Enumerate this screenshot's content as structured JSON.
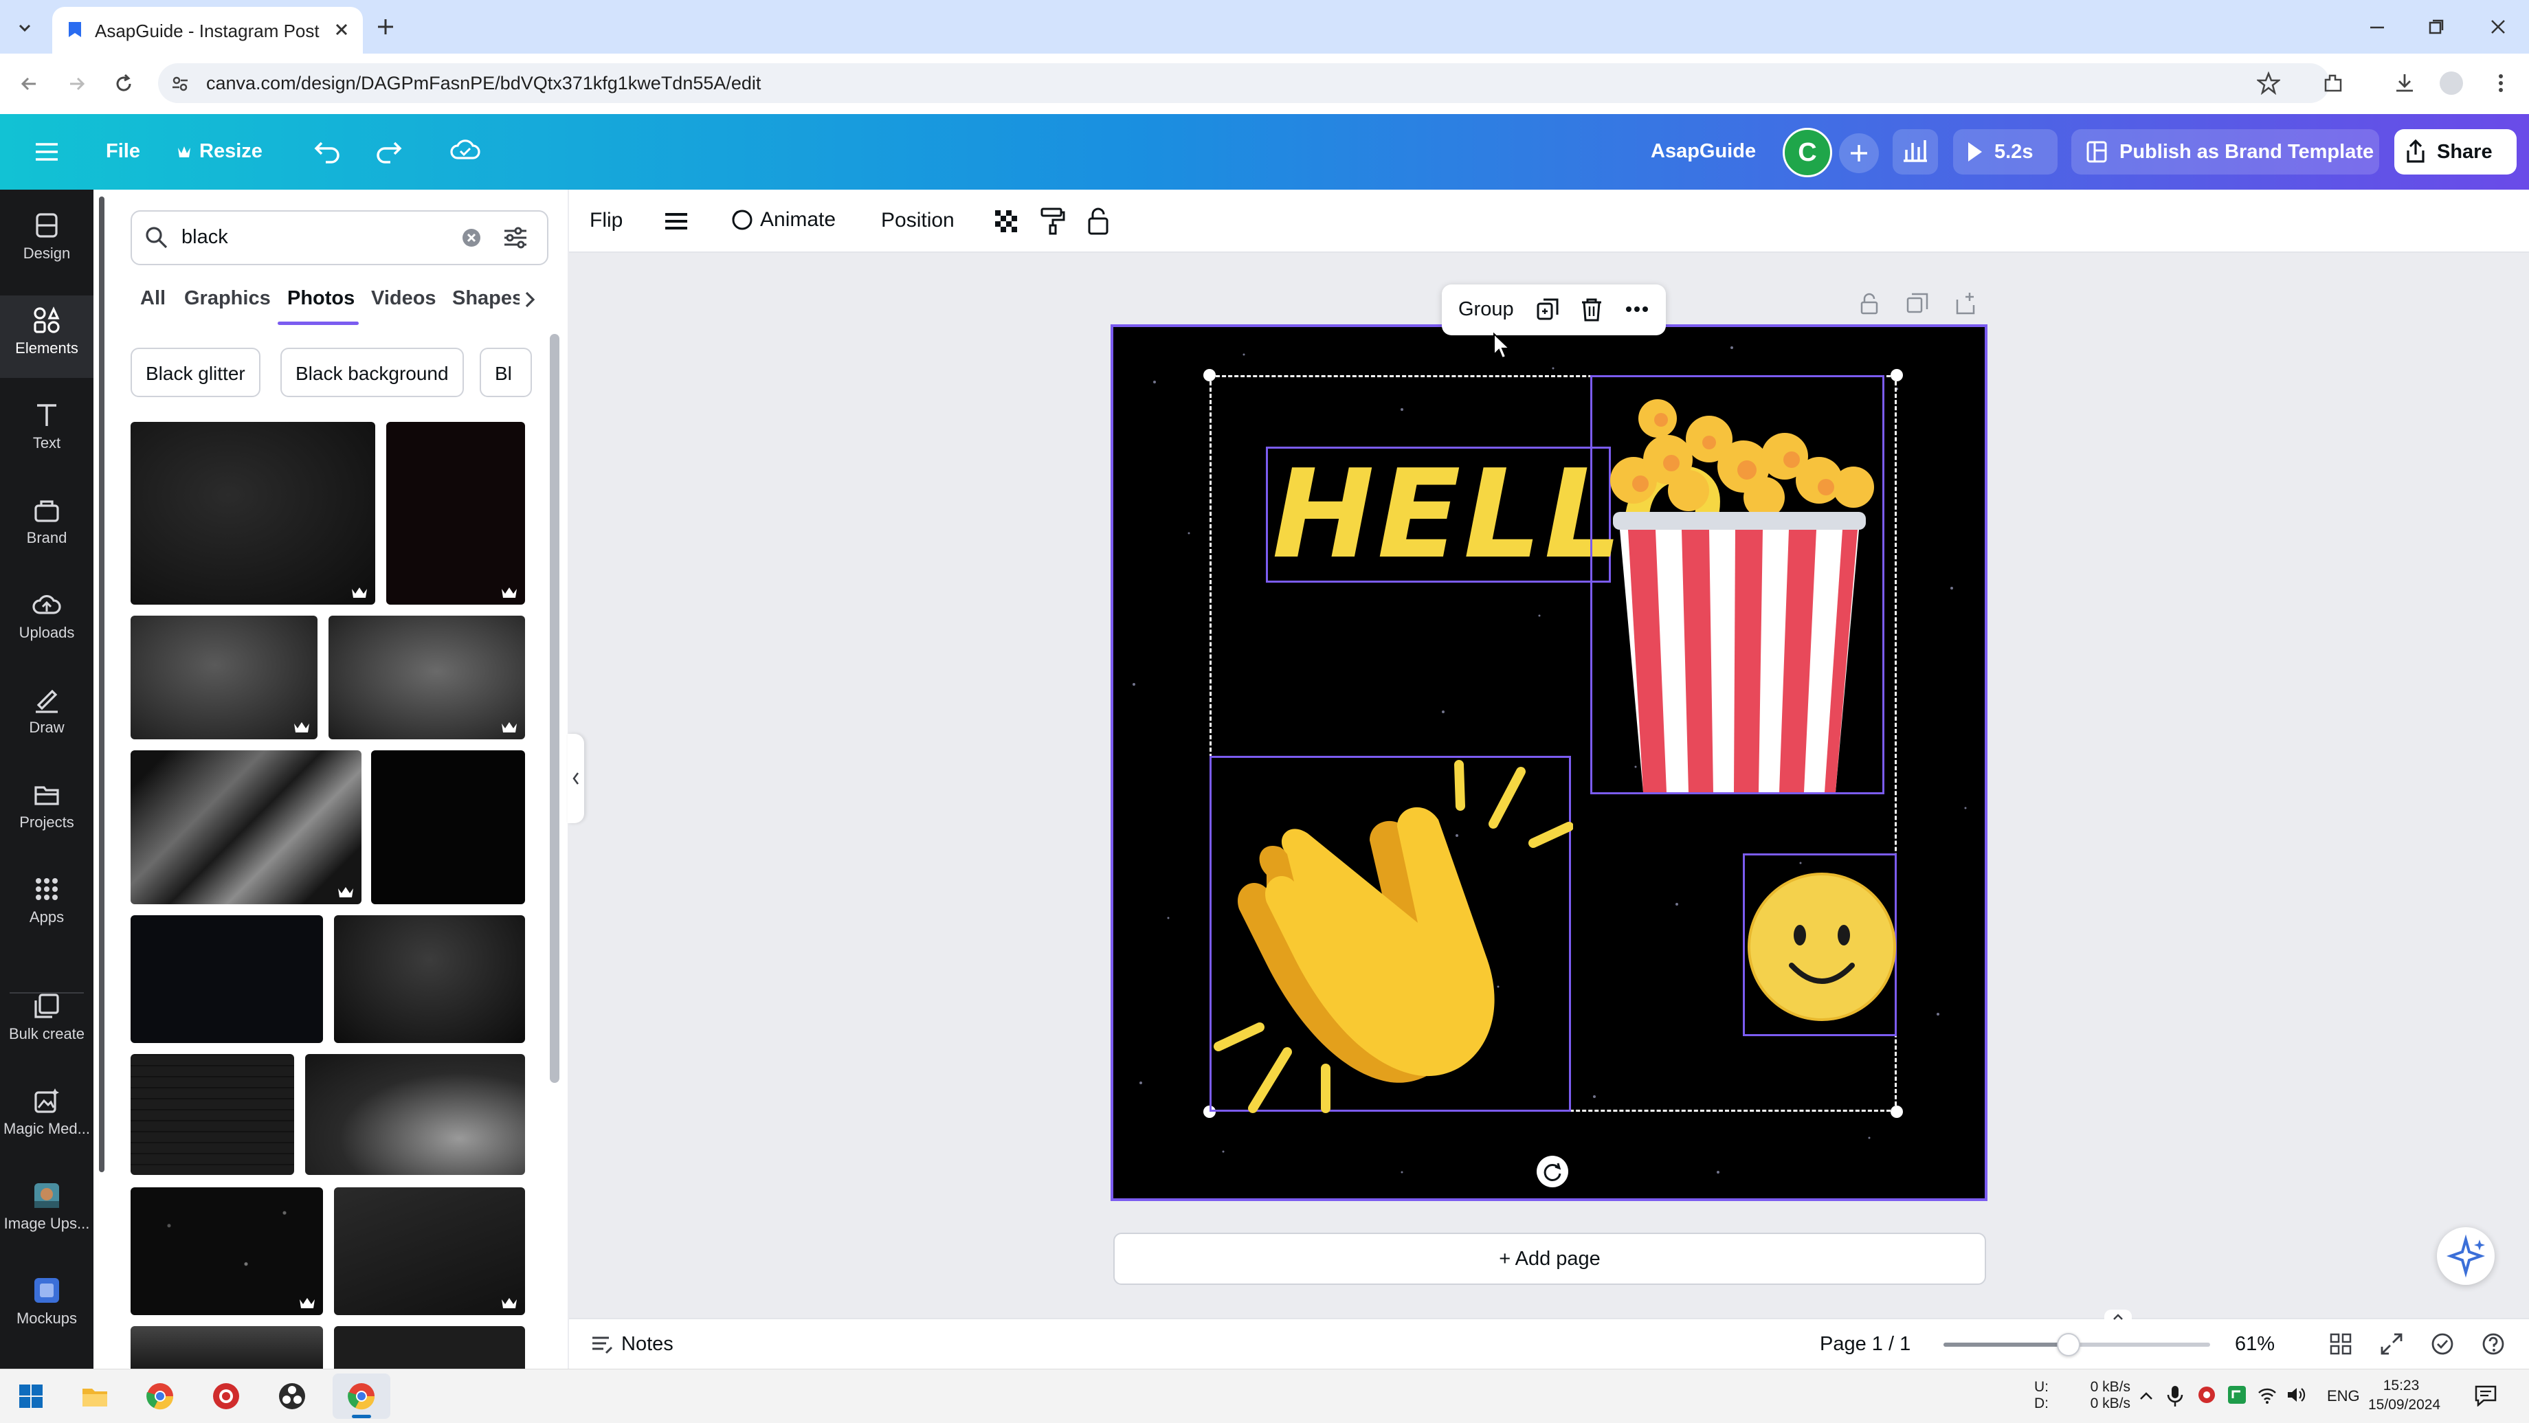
{
  "browser": {
    "tab_title": "AsapGuide - Instagram Post",
    "url": "canva.com/design/DAGPmFasnPE/bdVQtx371kfg1kweTdn55A/edit"
  },
  "header": {
    "menu_file": "File",
    "menu_resize": "Resize",
    "team_name": "AsapGuide",
    "avatar_letter": "C",
    "play_duration": "5.2s",
    "publish_label": "Publish as Brand Template",
    "share_label": "Share"
  },
  "rail": {
    "items": [
      {
        "label": "Design",
        "icon": "design-icon"
      },
      {
        "label": "Elements",
        "icon": "elements-icon"
      },
      {
        "label": "Text",
        "icon": "text-icon"
      },
      {
        "label": "Brand",
        "icon": "brand-icon"
      },
      {
        "label": "Uploads",
        "icon": "uploads-icon"
      },
      {
        "label": "Draw",
        "icon": "draw-icon"
      },
      {
        "label": "Projects",
        "icon": "projects-icon"
      },
      {
        "label": "Apps",
        "icon": "apps-icon"
      },
      {
        "label": "Bulk create",
        "icon": "bulk-create-icon"
      },
      {
        "label": "Magic Med...",
        "icon": "magic-media-icon"
      },
      {
        "label": "Image Ups...",
        "icon": "image-upscaler-icon"
      },
      {
        "label": "Mockups",
        "icon": "mockups-icon"
      }
    ],
    "active": "Elements"
  },
  "panel": {
    "search_value": "black",
    "filter_tabs": [
      "All",
      "Graphics",
      "Photos",
      "Videos",
      "Shapes"
    ],
    "active_filter": "Photos",
    "chips": [
      "Black glitter",
      "Black background",
      "Bl"
    ]
  },
  "toolbar": {
    "flip": "Flip",
    "animate": "Animate",
    "position": "Position"
  },
  "canvas": {
    "floating_group": "Group",
    "hello_text": "HELLO",
    "add_page": "+ Add page"
  },
  "footer": {
    "notes": "Notes",
    "page_indicator": "Page 1 / 1",
    "zoom": "61%",
    "zoom_fraction": 0.47
  },
  "taskbar": {
    "net_up_label": "U:",
    "net_down_label": "D:",
    "net_up": "0 kB/s",
    "net_down": "0 kB/s",
    "lang": "ENG",
    "time": "15:23",
    "date": "15/09/2024"
  },
  "colors": {
    "canva_accent": "#7b5cf0",
    "header_gradient_start": "#12c2d4",
    "header_gradient_end": "#6a4be8",
    "hello_yellow": "#f6d743"
  }
}
